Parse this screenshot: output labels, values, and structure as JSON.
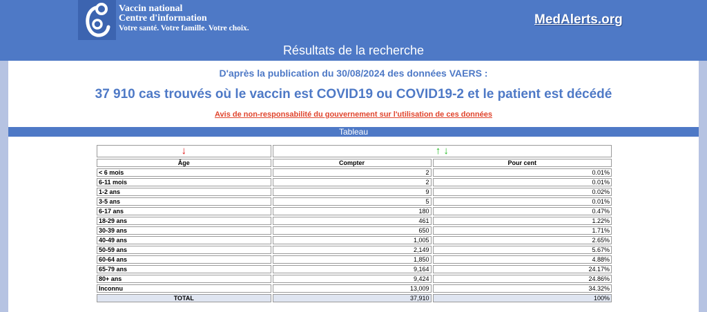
{
  "header": {
    "org_line1": "Vaccin national",
    "org_line2": "Centre d'information",
    "org_tagline": "Votre santé. Votre famille. Votre choix.",
    "site_name": "MedAlerts.org"
  },
  "title": "Résultats de la recherche",
  "pub_line": "D'après la publication du 30/08/2024 des données VAERS :",
  "headline": "37 910 cas trouvés où le vaccin est COVID19 ou COVID19-2 et le patient est décédé",
  "disclaimer": "Avis de non-responsabilité du gouvernement sur l'utilisation de ces données",
  "tableau_label": "Tableau",
  "table": {
    "sort_arrow_age": "↓",
    "sort_arrows_value": "↑ ↓",
    "columns": [
      "Âge",
      "Compter",
      "Pour cent"
    ],
    "rows": [
      {
        "label": "< 6 mois",
        "count": "2",
        "percent": "0.01%"
      },
      {
        "label": "6-11 mois",
        "count": "2",
        "percent": "0.01%"
      },
      {
        "label": "1-2 ans",
        "count": "9",
        "percent": "0.02%"
      },
      {
        "label": "3-5 ans",
        "count": "5",
        "percent": "0.01%"
      },
      {
        "label": "6-17 ans",
        "count": "180",
        "percent": "0.47%"
      },
      {
        "label": "18-29 ans",
        "count": "461",
        "percent": "1.22%"
      },
      {
        "label": "30-39 ans",
        "count": "650",
        "percent": "1.71%"
      },
      {
        "label": "40-49 ans",
        "count": "1,005",
        "percent": "2.65%"
      },
      {
        "label": "50-59 ans",
        "count": "2,149",
        "percent": "5.67%"
      },
      {
        "label": "60-64 ans",
        "count": "1,850",
        "percent": "4.88%"
      },
      {
        "label": "65-79 ans",
        "count": "9,164",
        "percent": "24.17%"
      },
      {
        "label": "80+ ans",
        "count": "9,424",
        "percent": "24.86%"
      },
      {
        "label": "Inconnu",
        "count": "13,009",
        "percent": "34.32%"
      }
    ],
    "total": {
      "label": "TOTAL",
      "count": "37,910",
      "percent": "100%"
    }
  },
  "colors": {
    "header_blue": "#4e79c6",
    "text_blue": "#4e79c6",
    "disclaimer_red": "#e0442c",
    "arrow_red": "#dd1111",
    "arrow_green": "#22bb22"
  }
}
